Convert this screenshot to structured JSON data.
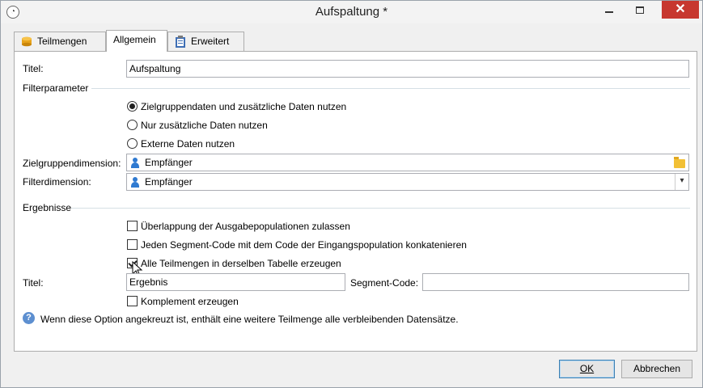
{
  "window": {
    "title": "Aufspaltung *"
  },
  "titlebar": {
    "minimize_icon": "minimize-icon",
    "maximize_icon": "maximize-icon",
    "close_glyph": "✕"
  },
  "tabs": [
    {
      "label": "Teilmengen",
      "icon": "database-icon"
    },
    {
      "label": "Allgemein",
      "active": true
    },
    {
      "label": "Erweitert",
      "icon": "clipboard-icon"
    }
  ],
  "form": {
    "title_label": "Titel:",
    "title_value": "Aufspaltung",
    "filter_group": "Filterparameter",
    "radios": [
      {
        "label": "Zielgruppendaten und zusätzliche Daten nutzen",
        "checked": true
      },
      {
        "label": "Nur zusätzliche Daten nutzen",
        "checked": false
      },
      {
        "label": "Externe Daten nutzen",
        "checked": false
      }
    ],
    "target_dim_label": "Zielgruppendimension:",
    "target_dim_value": "Empfänger",
    "filter_dim_label": "Filterdimension:",
    "filter_dim_value": "Empfänger",
    "results_group": "Ergebnisse",
    "checkboxes": [
      {
        "label": "Überlappung der Ausgabepopulationen zulassen",
        "checked": false
      },
      {
        "label": "Jeden Segment-Code mit dem Code der Eingangspopulation konkatenieren",
        "checked": false
      },
      {
        "label": "Alle Teilmengen in derselben Tabelle erzeugen",
        "checked": true
      }
    ],
    "result_title_label": "Titel:",
    "result_title_value": "Ergebnis",
    "segment_code_label": "Segment-Code:",
    "segment_code_value": "",
    "complement_label": "Komplement erzeugen",
    "complement_checked": false,
    "help_text": "Wenn diese Option angekreuzt ist, enthält eine weitere Teilmenge alle verbleibenden Datensätze."
  },
  "buttons": {
    "ok": "OK",
    "cancel": "Abbrechen"
  }
}
